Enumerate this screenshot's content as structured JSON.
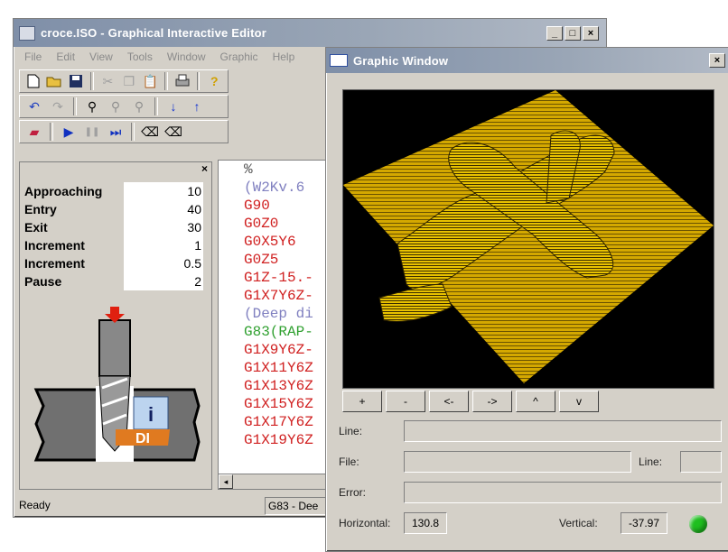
{
  "main_window": {
    "title": "croce.ISO - Graphical Interactive Editor",
    "menu": [
      "File",
      "Edit",
      "View",
      "Tools",
      "Window",
      "Graphic",
      "Help"
    ],
    "status_text": "Ready",
    "status_mode": "G83 - Dee"
  },
  "parameters": [
    {
      "label": "Approaching",
      "value": "10"
    },
    {
      "label": "Entry",
      "value": "40"
    },
    {
      "label": "Exit",
      "value": "30"
    },
    {
      "label": "Increment",
      "value": "1"
    },
    {
      "label": "Increment",
      "value": "0.5"
    },
    {
      "label": "Pause",
      "value": "2"
    }
  ],
  "diagram_labels": {
    "i": "i",
    "di": "DI"
  },
  "code_lines": [
    {
      "text": "%",
      "color": "#555555"
    },
    {
      "text": "(W2Kv.6",
      "color": "#8080c0"
    },
    {
      "text": "G90",
      "color": "#d02020"
    },
    {
      "text": "G0Z0",
      "color": "#d02020"
    },
    {
      "text": "G0X5Y6",
      "color": "#d02020"
    },
    {
      "text": "G0Z5",
      "color": "#d02020"
    },
    {
      "text": "G1Z-15.-",
      "color": "#d02020"
    },
    {
      "text": "G1X7Y6Z-",
      "color": "#d02020"
    },
    {
      "text": "(Deep di",
      "color": "#8080c0"
    },
    {
      "text": "G83(RAP-",
      "color": "#30a030"
    },
    {
      "text": "G1X9Y6Z-",
      "color": "#d02020"
    },
    {
      "text": "G1X11Y6Z",
      "color": "#d02020"
    },
    {
      "text": "G1X13Y6Z",
      "color": "#d02020"
    },
    {
      "text": "G1X15Y6Z",
      "color": "#d02020"
    },
    {
      "text": "G1X17Y6Z",
      "color": "#d02020"
    },
    {
      "text": "G1X19Y6Z",
      "color": "#d02020"
    }
  ],
  "graphic_window": {
    "title": "Graphic Window",
    "nav_buttons": [
      "+",
      "-",
      "<-",
      "->",
      "^",
      "v"
    ],
    "labels": {
      "line": "Line:",
      "file": "File:",
      "line2": "Line:",
      "error": "Error:",
      "horizontal": "Horizontal:",
      "vertical": "Vertical:"
    },
    "horizontal_value": "130.8",
    "vertical_value": "-37.97",
    "status_color": "#1fbf1f"
  }
}
